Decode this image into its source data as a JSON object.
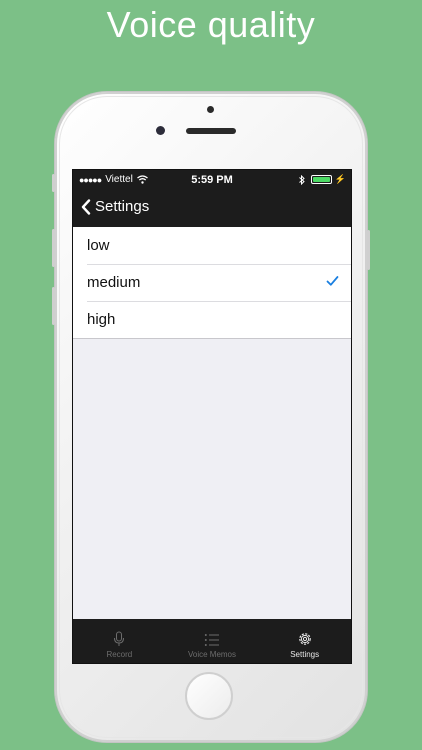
{
  "headline": "Voice quality",
  "status_bar": {
    "signal": "●●●●●",
    "carrier": "Viettel",
    "time": "5:59 PM"
  },
  "nav": {
    "back_label": "Settings"
  },
  "quality_options": [
    {
      "label": "low",
      "selected": false
    },
    {
      "label": "medium",
      "selected": true
    },
    {
      "label": "high",
      "selected": false
    }
  ],
  "tabs": [
    {
      "label": "Record",
      "icon": "microphone-icon",
      "active": false
    },
    {
      "label": "Voice Memos",
      "icon": "list-icon",
      "active": false
    },
    {
      "label": "Settings",
      "icon": "gear-icon",
      "active": true
    }
  ],
  "colors": {
    "background": "#7cc087",
    "checkmark": "#1a7fe0",
    "battery": "#4cd964",
    "bars": "#1c1c1c"
  }
}
